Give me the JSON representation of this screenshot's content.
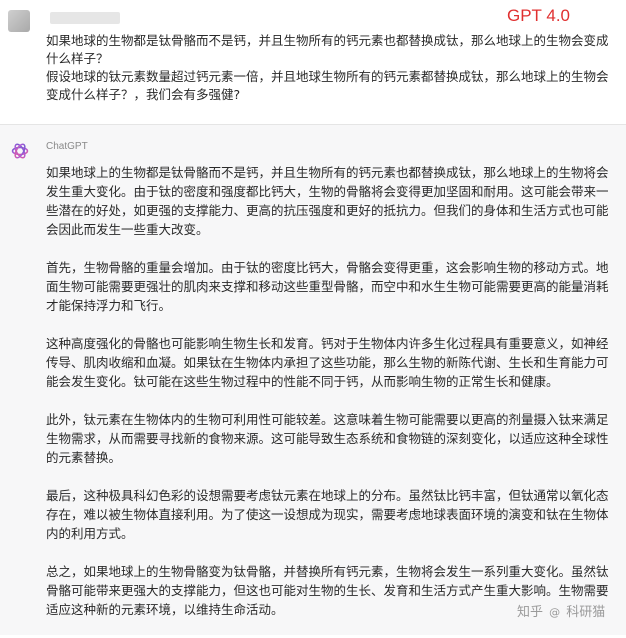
{
  "question": {
    "model_label": "GPT 4.0",
    "lines": [
      "如果地球的生物都是钛骨骼而不是钙，并且生物所有的钙元素也都替换成钛，那么地球上的生物会变成什么样子？",
      "假设地球的钛元素数量超过钙元素一倍，并且地球生物所有的钙元素都替换成钛，那么地球上的生物会变成什么样子？，我们会有多强健?"
    ]
  },
  "answer": {
    "sender": "ChatGPT",
    "avatar_icon": "openai-logo",
    "paragraphs": [
      "如果地球上的生物都是钛骨骼而不是钙，并且生物所有的钙元素也都替换成钛，那么地球上的生物将会发生重大变化。由于钛的密度和强度都比钙大，生物的骨骼将会变得更加坚固和耐用。这可能会带来一些潜在的好处，如更强的支撑能力、更高的抗压强度和更好的抵抗力。但我们的身体和生活方式也可能会因此而发生一些重大改变。",
      "首先，生物骨骼的重量会增加。由于钛的密度比钙大，骨骼会变得更重，这会影响生物的移动方式。地面生物可能需要更强壮的肌肉来支撑和移动这些重型骨骼，而空中和水生生物可能需要更高的能量消耗才能保持浮力和飞行。",
      "这种高度强化的骨骼也可能影响生物生长和发育。钙对于生物体内许多生化过程具有重要意义，如神经传导、肌肉收缩和血凝。如果钛在生物体内承担了这些功能，那么生物的新陈代谢、生长和生育能力可能会发生变化。钛可能在这些生物过程中的性能不同于钙，从而影响生物的正常生长和健康。",
      "此外，钛元素在生物体内的生物可利用性可能较差。这意味着生物可能需要以更高的剂量摄入钛来满足生物需求，从而需要寻找新的食物来源。这可能导致生态系统和食物链的深刻变化，以适应这种全球性的元素替换。",
      "最后，这种极具科幻色彩的设想需要考虑钛元素在地球上的分布。虽然钛比钙丰富，但钛通常以氧化态存在，难以被生物体直接利用。为了使这一设想成为现实，需要考虑地球表面环境的演变和钛在生物体内的利用方式。",
      "总之，如果地球上的生物骨骼变为钛骨骼，并替换所有钙元素，生物将会发生一系列重大变化。虽然钛骨骼可能带来更强大的支撑能力，但这也可能对生物的生长、发育和生活方式产生重大影响。生物需要适应这种新的元素环境，以维持生命活动。"
    ]
  },
  "watermark": {
    "site": "知乎",
    "at": "@",
    "author": "科研猫"
  }
}
